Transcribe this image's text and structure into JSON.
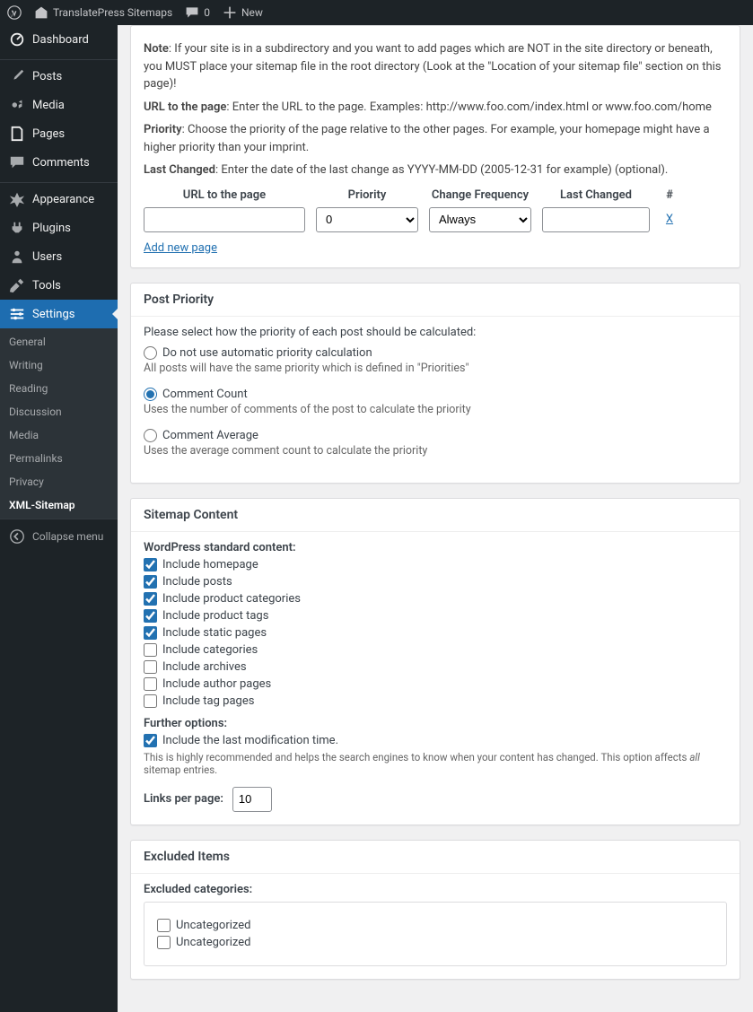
{
  "toolbar": {
    "site_name": "TranslatePress Sitemaps",
    "comments": "0",
    "new": "New"
  },
  "sidebar": {
    "dashboard": "Dashboard",
    "posts": "Posts",
    "media": "Media",
    "pages": "Pages",
    "comments": "Comments",
    "appearance": "Appearance",
    "plugins": "Plugins",
    "users": "Users",
    "tools": "Tools",
    "settings": "Settings",
    "collapse": "Collapse menu",
    "sub": {
      "general": "General",
      "writing": "Writing",
      "reading": "Reading",
      "discussion": "Discussion",
      "media": "Media",
      "permalinks": "Permalinks",
      "privacy": "Privacy",
      "xmlsitemap": "XML-Sitemap"
    }
  },
  "pages_section": {
    "note_label": "Note",
    "note_text": ": If your site is in a subdirectory and you want to add pages which are NOT in the site directory or beneath, you MUST place your sitemap file in the root directory (Look at the \"Location of your sitemap file\" section on this page)!",
    "url_label": "URL to the page",
    "url_text": ": Enter the URL to the page. Examples: http://www.foo.com/index.html or www.foo.com/home",
    "priority_label": "Priority",
    "priority_text": ": Choose the priority of the page relative to the other pages. For example, your homepage might have a higher priority than your imprint.",
    "lastchanged_label": "Last Changed",
    "lastchanged_text": ": Enter the date of the last change as YYYY-MM-DD (2005-12-31 for example) (optional).",
    "headers": {
      "url": "URL to the page",
      "pri": "Priority",
      "freq": "Change Frequency",
      "last": "Last Changed",
      "del": "#"
    },
    "row": {
      "url": "",
      "pri": "0",
      "freq": "Always",
      "last": "",
      "del": "X"
    },
    "add": "Add new page"
  },
  "post_priority": {
    "title": "Post Priority",
    "intro": "Please select how the priority of each post should be calculated:",
    "opt1": "Do not use automatic priority calculation",
    "opt1_help": "All posts will have the same priority which is defined in \"Priorities\"",
    "opt2": "Comment Count",
    "opt2_help": "Uses the number of comments of the post to calculate the priority",
    "opt3": "Comment Average",
    "opt3_help": "Uses the average comment count to calculate the priority"
  },
  "sitemap_content": {
    "title": "Sitemap Content",
    "std_label": "WordPress standard content:",
    "c1": "Include homepage",
    "c2": "Include posts",
    "c3": "Include product categories",
    "c4": "Include product tags",
    "c5": "Include static pages",
    "c6": "Include categories",
    "c7": "Include archives",
    "c8": "Include author pages",
    "c9": "Include tag pages",
    "further": "Further options:",
    "c10": "Include the last modification time.",
    "help_pre": "This is highly recommended and helps the search engines to know when your content has changed. This option affects ",
    "help_em": "all",
    "help_post": " sitemap entries.",
    "lpp_label": "Links per page:",
    "lpp_value": "10"
  },
  "excluded": {
    "title": "Excluded Items",
    "cats_label": "Excluded categories:",
    "cat1": "Uncategorized",
    "cat2": "Uncategorized"
  }
}
